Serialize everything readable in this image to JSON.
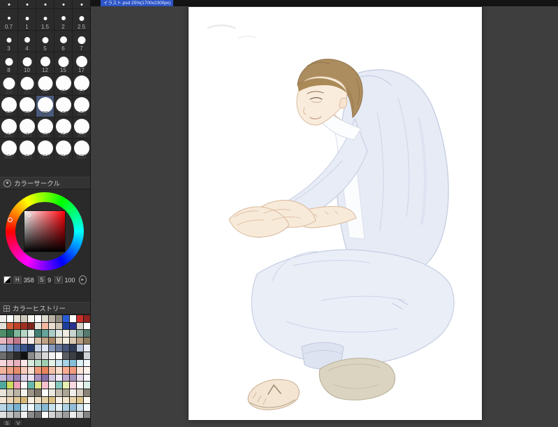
{
  "titlebar": {
    "document_text": "イラスト.psd 25%(1700x2300px)"
  },
  "brush_panel": {
    "selected_label": "80",
    "rows": [
      {
        "partial": true,
        "labels": [
          "",
          "",
          "",
          "",
          ""
        ],
        "sizes": [
          0.5,
          0.5,
          0.5,
          0.5,
          0.5
        ]
      },
      {
        "labels": [
          "0.7",
          "1",
          "1.5",
          "2",
          "2.5"
        ],
        "sizes": [
          0.7,
          1,
          1.5,
          2,
          2.5
        ]
      },
      {
        "labels": [
          "3",
          "4",
          "5",
          "6",
          "7"
        ],
        "sizes": [
          3,
          4,
          5,
          6,
          7
        ]
      },
      {
        "labels": [
          "8",
          "10",
          "12",
          "15",
          "17"
        ],
        "sizes": [
          8,
          10,
          12,
          15,
          17
        ]
      },
      {
        "labels": [
          "20",
          "25",
          "30",
          "40",
          "50"
        ],
        "sizes": [
          20,
          25,
          30,
          40,
          50
        ]
      },
      {
        "labels": [
          "60",
          "70",
          "80",
          "100",
          "120"
        ],
        "sizes": [
          60,
          70,
          80,
          100,
          120
        ]
      },
      {
        "labels": [
          "150",
          "170",
          "200",
          "250",
          "300"
        ],
        "sizes": [
          150,
          170,
          200,
          250,
          300
        ]
      },
      {
        "labels": [
          "400",
          "500",
          "600",
          "700",
          "800"
        ],
        "sizes": [
          400,
          500,
          600,
          700,
          800
        ]
      }
    ]
  },
  "color_circle": {
    "title": "カラーサークル",
    "labels": {
      "h": "H",
      "s": "S",
      "v": "V"
    },
    "values": {
      "h": "358",
      "s": "9",
      "v": "100"
    },
    "button_glyph": "▸",
    "hue_hex": "#ff0008"
  },
  "color_history": {
    "title": "カラーヒストリー",
    "rows": [
      [
        "#f2f0ea",
        "#ffffff",
        "#e6e2d8",
        "#cfc9bc",
        "#f7f5f0",
        "#ffffff",
        "#dedacf",
        "#b9b2a4",
        "#8e897d",
        "#2a5bd7",
        "#ffffff",
        "#c9302c",
        "#8f2420"
      ],
      [
        "#e2dfd6",
        "#d45f3c",
        "#c14227",
        "#a03020",
        "#7e241a",
        "#e8e4dc",
        "#f4b8a0",
        "#eadfce",
        "#ccc4b4",
        "#1d3f9e",
        "#27318f",
        "#d8d4ce",
        "#ffffff"
      ],
      [
        "#4f8f6a",
        "#2e7050",
        "#7fb89a",
        "#b6d6c6",
        "#e3efe8",
        "#3f7f74",
        "#66a39a",
        "#a9cdc6",
        "#dfe9e4",
        "#f0ece2",
        "#c9d6cf",
        "#88aaa0",
        "#567a70"
      ],
      [
        "#e8b8c0",
        "#d897a8",
        "#c07888",
        "#f2d8da",
        "#f8ecec",
        "#d8c0a8",
        "#c0a488",
        "#a88868",
        "#e8dcc8",
        "#f4eee0",
        "#d9c9b0",
        "#b89f80",
        "#8f7a5e"
      ],
      [
        "#9fb4d8",
        "#7a94c6",
        "#5670a8",
        "#39548c",
        "#24386a",
        "#c6d2e8",
        "#dfe6f2",
        "#8898b8",
        "#68789c",
        "#48587c",
        "#303c58",
        "#b8c4dc",
        "#e9eef6"
      ],
      [
        "#6e6e6e",
        "#4c4c4c",
        "#2b2b2b",
        "#111111",
        "#8c8c8c",
        "#b4b4b4",
        "#d8d8d8",
        "#f2f2f2",
        "#ffffff",
        "#5a5f66",
        "#3c4046",
        "#23262a",
        "#cfd2d6"
      ],
      [
        "#f6d8dc",
        "#f0c4cc",
        "#e8b0bc",
        "#fce8ea",
        "#d8ecdf",
        "#bcdfc9",
        "#9fd0b2",
        "#e4f2ea",
        "#cfe8f4",
        "#a8d4e8",
        "#84c0dc",
        "#def0f8",
        "#f4fafc"
      ],
      [
        "#f2b49c",
        "#eda184",
        "#e68d6c",
        "#f8ccba",
        "#fbe2d6",
        "#ef9a7a",
        "#e8855e",
        "#f5c0a8",
        "#fcdccb",
        "#f8ad92",
        "#f19a7e",
        "#fce4d8",
        "#fff4ec"
      ],
      [
        "#c8b8d8",
        "#b09cc8",
        "#9880b4",
        "#e0d6ec",
        "#ece4f4",
        "#a890c0",
        "#8870a8",
        "#d4c8e4",
        "#f0eaf6",
        "#bcaad0",
        "#a492be",
        "#e6deef",
        "#f8f4fc"
      ],
      [
        "#4fa89c",
        "#cddc5e",
        "#f0a0b8",
        "#ffffff",
        "#68b8ac",
        "#dfe88a",
        "#f6c0d0",
        "#f4f2ec",
        "#88c8be",
        "#eaf0b0",
        "#fad8e2",
        "#fcfbf8",
        "#dcefe9"
      ],
      [
        "#e8e4da",
        "#d2cbbd",
        "#bab2a2",
        "#f6f4ef",
        "#9c9486",
        "#7e766a",
        "#ffffff",
        "#ece9e2",
        "#c6beae",
        "#ada595",
        "#f1efe9",
        "#d8d1c3",
        "#8a8376"
      ],
      [
        "#f4e8d8",
        "#ecd8b8",
        "#e2c898",
        "#d8b878",
        "#f8f0e2",
        "#efe0c4",
        "#e6d0a4",
        "#dcc084",
        "#faf4e8",
        "#f2e6cc",
        "#e9d6ac",
        "#dfc68c",
        "#fcf8f0"
      ],
      [
        "#b8d8e8",
        "#98c4dc",
        "#78b0d0",
        "#d8ecf4",
        "#f0f8fc",
        "#a8cee2",
        "#88bad6",
        "#c8e2ee",
        "#e8f4f8",
        "#b0d2e4",
        "#90bed8",
        "#d0e6f0",
        "#f4fafc"
      ],
      [
        "#e0e0e0",
        "#c4c4c4",
        "#a8a8a8",
        "#f0f0f0",
        "#8c8c8c",
        "#707070",
        "#fafafa",
        "#d4d4d4",
        "#b8b8b8",
        "#9c9c9c",
        "#ececec",
        "#cccccc",
        "#848484"
      ]
    ]
  },
  "bottom_tabs": {
    "s": "S",
    "v": "V"
  }
}
